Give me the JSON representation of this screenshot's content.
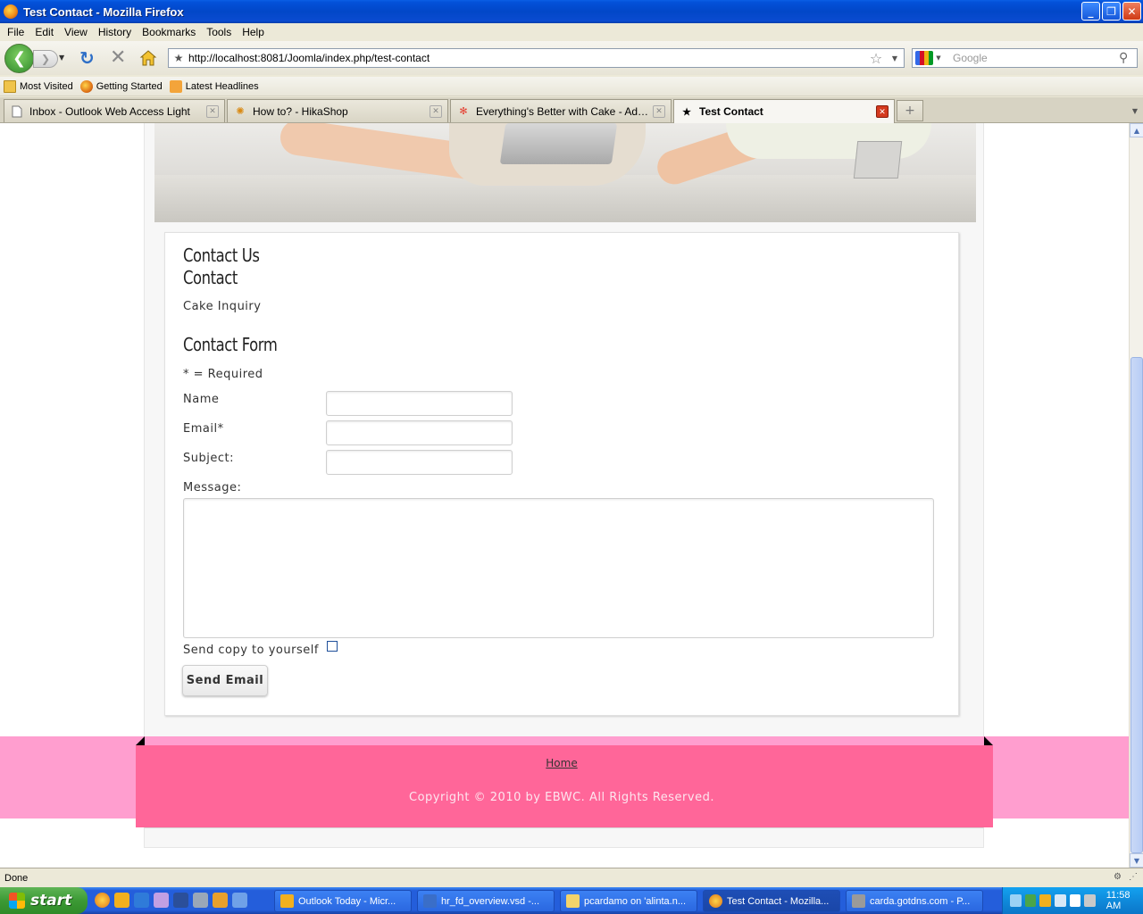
{
  "window": {
    "title": "Test Contact - Mozilla Firefox",
    "buttons": {
      "minimize": "_",
      "maximize": "❐",
      "close": "✕"
    }
  },
  "menu": [
    "File",
    "Edit",
    "View",
    "History",
    "Bookmarks",
    "Tools",
    "Help"
  ],
  "toolbar": {
    "url": "http://localhost:8081/Joomla/index.php/test-contact",
    "search_placeholder": "Google"
  },
  "bookmarks": [
    {
      "label": "Most Visited",
      "icon": "folder-icon"
    },
    {
      "label": "Getting Started",
      "icon": "firefox-icon"
    },
    {
      "label": "Latest Headlines",
      "icon": "rss-icon"
    }
  ],
  "tabs": [
    {
      "label": "Inbox - Outlook Web Access Light",
      "icon": "page-icon",
      "active": false
    },
    {
      "label": "How to? - HikaShop",
      "icon": "hikashop-icon",
      "active": false
    },
    {
      "label": "Everything's Better with Cake - Adminis...",
      "icon": "joomla-icon",
      "active": false
    },
    {
      "label": "Test Contact",
      "icon": "star-icon",
      "active": true
    }
  ],
  "page": {
    "title": "Contact Us",
    "subtitle": "Contact",
    "contact_name": "Cake Inquiry",
    "form_heading": "Contact Form",
    "required_note": "* = Required",
    "fields": {
      "name_label": "Name",
      "email_label": "Email*",
      "subject_label": "Subject:",
      "message_label": "Message:",
      "copy_label": "Send copy to yourself"
    },
    "send_button": "Send Email",
    "footer": {
      "home_link": "Home",
      "copyright": "Copyright © 2010 by EBWC. All Rights Reserved."
    }
  },
  "status": "Done",
  "taskbar": {
    "start": "start",
    "tasks": [
      {
        "label": "Outlook Today - Micr...",
        "color": "#f2b01e"
      },
      {
        "label": "hr_fd_overview.vsd -...",
        "color": "#3a6ec8"
      },
      {
        "label": "pcardamo on 'alinta.n...",
        "color": "#f3d36a"
      },
      {
        "label": "Test Contact - Mozilla...",
        "color": "#e07518"
      },
      {
        "label": "carda.gotdns.com - P...",
        "color": "#9a9a9a"
      }
    ],
    "clock": "11:58 AM"
  },
  "colors": {
    "footer_pink": "#ff6699",
    "footer_band": "#ff9ecf",
    "xp_blue": "#245edb"
  }
}
